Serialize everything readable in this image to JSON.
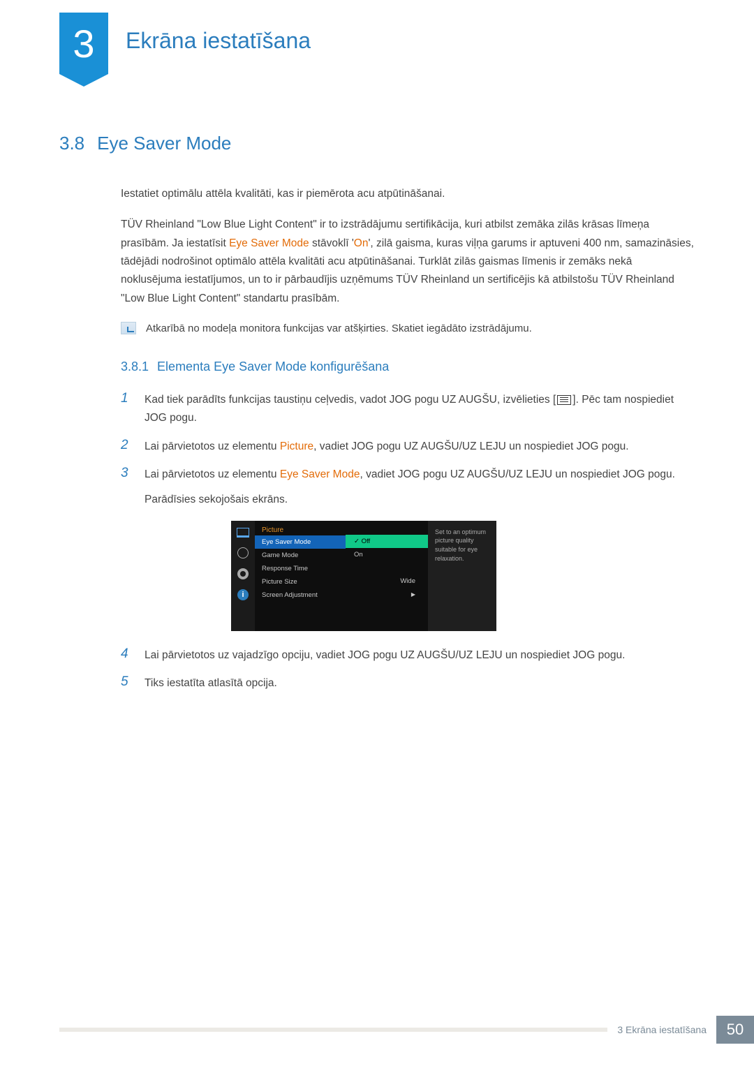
{
  "chapter": {
    "number": "3",
    "title": "Ekrāna iestatīšana"
  },
  "section": {
    "number": "3.8",
    "title": "Eye Saver Mode"
  },
  "intro": "Iestatiet optimālu attēla kvalitāti, kas ir piemērota acu atpūtināšanai.",
  "para2_a": "TÜV Rheinland \"Low Blue Light Content\" ir to izstrādājumu sertifikācija, kuri atbilst zemāka zilās krāsas līmeņa prasībām. Ja iestatīsit ",
  "para2_b": "Eye Saver Mode",
  "para2_c": " stāvoklī '",
  "para2_d": "On",
  "para2_e": "', zilā gaisma, kuras viļņa garums ir aptuveni 400 nm, samazināsies, tādējādi nodrošinot optimālo attēla kvalitāti acu atpūtināšanai. Turklāt zilās gaismas līmenis ir zemāks nekā noklusējuma iestatījumos, un to ir pārbaudījis uzņēmums TÜV Rheinland un sertificējis kā atbilstošu TÜV Rheinland \"Low Blue Light Content\" standartu prasībām.",
  "note": "Atkarībā no modeļa monitora funkcijas var atšķirties. Skatiet iegādāto izstrādājumu.",
  "subsection": {
    "number": "3.8.1",
    "title": "Elementa Eye Saver Mode konfigurēšana"
  },
  "steps": {
    "s1_a": "Kad tiek parādīts funkcijas taustiņu ceļvedis, vadot JOG pogu UZ AUGŠU, izvēlieties [",
    "s1_b": "]. Pēc tam nospiediet JOG pogu.",
    "s2_a": "Lai pārvietotos uz elementu ",
    "s2_b": "Picture",
    "s2_c": ", vadiet JOG pogu UZ AUGŠU/UZ LEJU un nospiediet JOG pogu.",
    "s3_a": "Lai pārvietotos uz elementu ",
    "s3_b": "Eye Saver Mode",
    "s3_c": ", vadiet JOG pogu UZ AUGŠU/UZ LEJU un nospiediet JOG pogu.",
    "s3_d": "Parādīsies sekojošais ekrāns.",
    "s4": "Lai pārvietotos uz vajadzīgo opciju, vadiet JOG pogu UZ AUGŠU/UZ LEJU un nospiediet JOG pogu.",
    "s5": "Tiks iestatīta atlasītā opcija."
  },
  "osd": {
    "menu_title": "Picture",
    "items": [
      "Eye Saver Mode",
      "Game Mode",
      "Response Time",
      "Picture Size",
      "Screen Adjustment"
    ],
    "picture_size_value": "Wide",
    "values": [
      "Off",
      "On"
    ],
    "desc": "Set to an optimum picture quality suitable for eye relaxation.",
    "info_i": "i"
  },
  "footer": {
    "label": "3 Ekrāna iestatīšana",
    "page": "50"
  }
}
